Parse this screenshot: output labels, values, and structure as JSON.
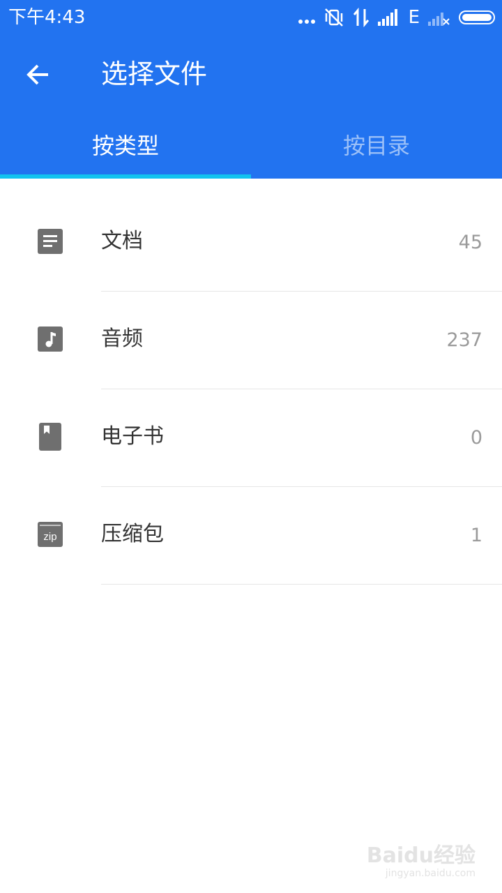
{
  "status_bar": {
    "time": "下午4:43",
    "network_label": "E",
    "icons": [
      "more-dots-icon",
      "vibrate-off-icon",
      "data-transfer-icon",
      "signal-icon",
      "signal-off-icon",
      "battery-icon"
    ]
  },
  "app_bar": {
    "title": "选择文件",
    "back_icon": "arrow-left-icon",
    "color": "#2273f0"
  },
  "tabs": [
    {
      "label": "按类型",
      "active": true
    },
    {
      "label": "按目录",
      "active": false
    }
  ],
  "tab_indicator_color": "#12c3ef",
  "categories": [
    {
      "label": "文档",
      "count": "45",
      "icon": "document-icon"
    },
    {
      "label": "音频",
      "count": "237",
      "icon": "music-icon"
    },
    {
      "label": "电子书",
      "count": "0",
      "icon": "ebook-icon"
    },
    {
      "label": "压缩包",
      "count": "1",
      "icon": "zip-icon"
    }
  ],
  "watermark": {
    "brand": "Baidu经验",
    "domain": "jingyan.baidu.com"
  }
}
